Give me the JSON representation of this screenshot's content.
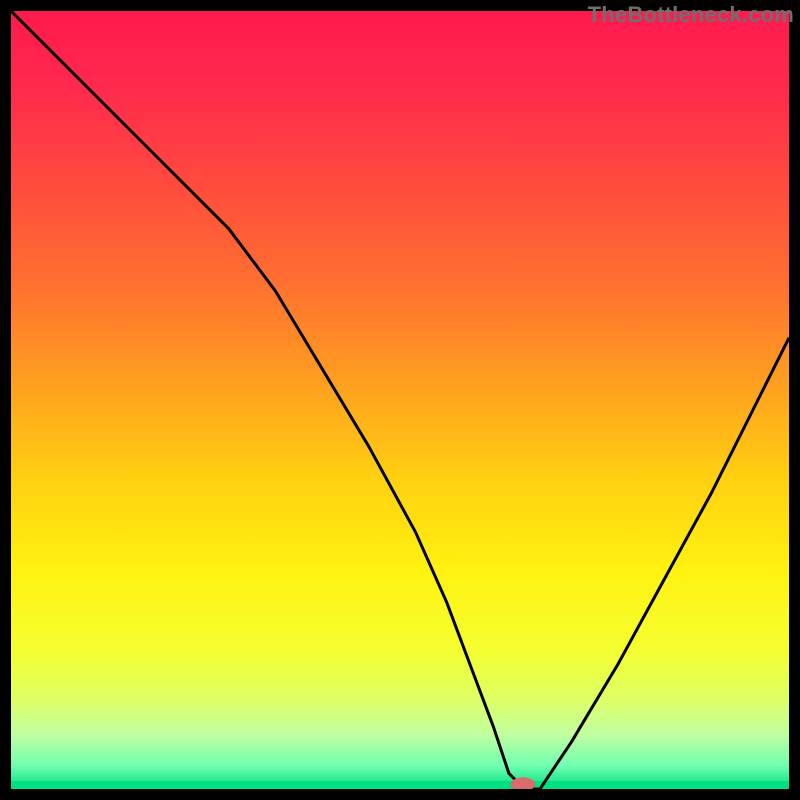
{
  "watermark": {
    "text": "TheBottleneck.com"
  },
  "colors": {
    "border": "#000000",
    "curve": "#000000",
    "marker_fill": "#d86b6b",
    "gradient_stops": [
      {
        "offset": 0.0,
        "color": "#ff1a4d"
      },
      {
        "offset": 0.1,
        "color": "#ff2a4d"
      },
      {
        "offset": 0.22,
        "color": "#ff4a3e"
      },
      {
        "offset": 0.35,
        "color": "#ff7030"
      },
      {
        "offset": 0.48,
        "color": "#ffa020"
      },
      {
        "offset": 0.6,
        "color": "#ffd010"
      },
      {
        "offset": 0.72,
        "color": "#fff210"
      },
      {
        "offset": 0.82,
        "color": "#f5ff30"
      },
      {
        "offset": 0.88,
        "color": "#e0ff60"
      },
      {
        "offset": 0.93,
        "color": "#c0ffa0"
      },
      {
        "offset": 0.97,
        "color": "#70ffb0"
      },
      {
        "offset": 1.0,
        "color": "#00e080"
      }
    ]
  },
  "chart_data": {
    "type": "line",
    "title": "",
    "xlabel": "",
    "ylabel": "",
    "xlim": [
      0,
      100
    ],
    "ylim": [
      0,
      100
    ],
    "grid": false,
    "legend": false,
    "series": [
      {
        "name": "bottleneck-curve",
        "x": [
          0,
          8,
          16,
          24,
          28,
          34,
          40,
          46,
          52,
          56,
          59,
          62,
          64,
          66,
          68,
          72,
          78,
          84,
          90,
          96,
          100
        ],
        "y": [
          100,
          92,
          84,
          76,
          72,
          64,
          54,
          44,
          33,
          24,
          16,
          8,
          2,
          0,
          0,
          6,
          16,
          27,
          38,
          50,
          58
        ]
      }
    ],
    "marker": {
      "name": "optimal-point",
      "x": 65.8,
      "y": 0.6,
      "rx": 1.6,
      "ry": 0.9
    },
    "annotations": []
  }
}
